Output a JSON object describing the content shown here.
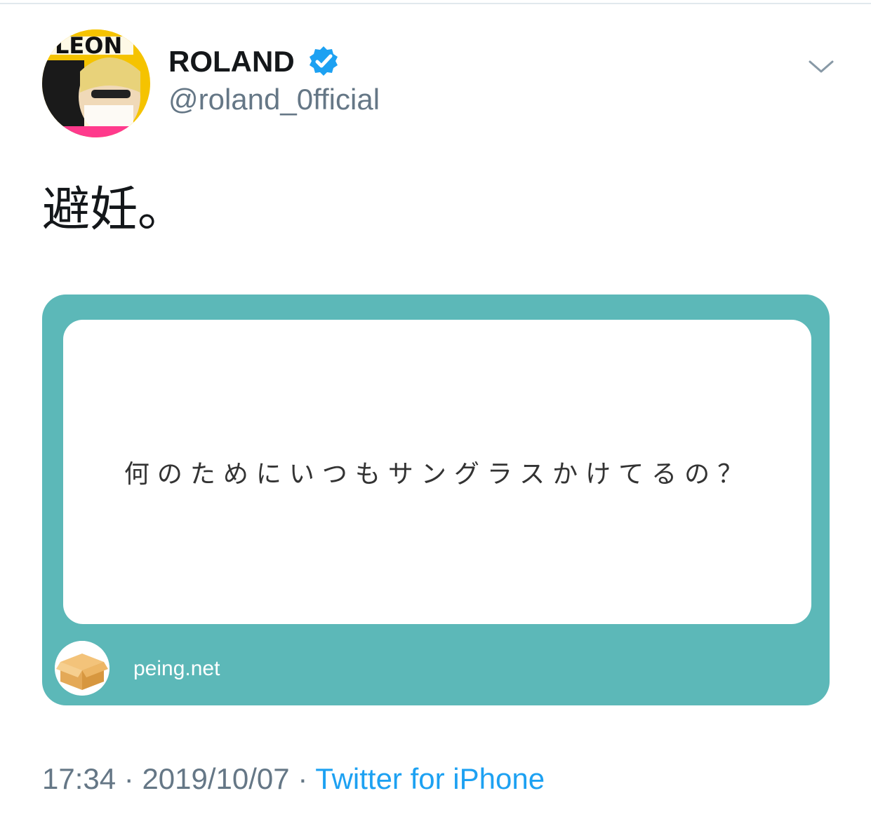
{
  "user": {
    "display_name": "ROLAND",
    "handle": "@roland_0fficial",
    "verified_icon": "verified-badge-icon",
    "verified_color": "#1da1f2"
  },
  "tweet": {
    "text": "避妊。"
  },
  "card": {
    "question": "何のためにいつもサングラスかけてるの？",
    "domain": "peing.net",
    "bg_color": "#5cb8b8"
  },
  "meta": {
    "time": "17:34",
    "separator1": " · ",
    "date": "2019/10/07",
    "separator2": " · ",
    "source": "Twitter for iPhone",
    "source_color": "#1da1f2"
  }
}
